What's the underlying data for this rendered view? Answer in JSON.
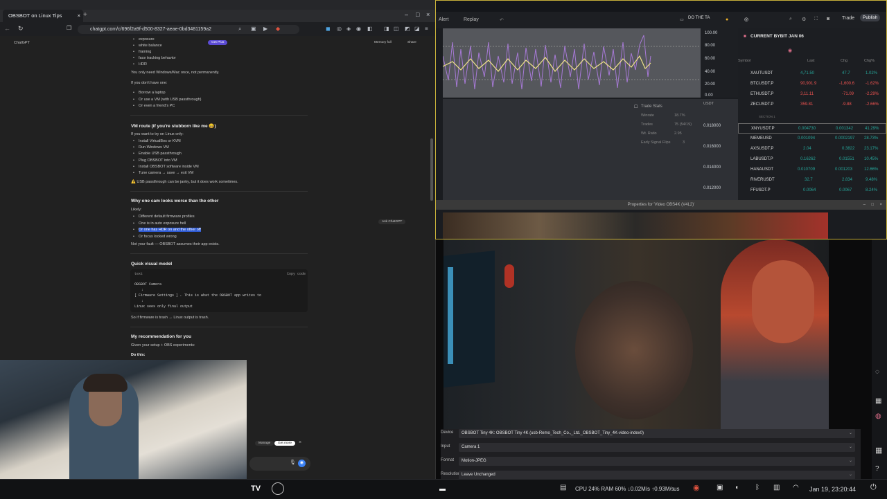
{
  "browser": {
    "tabs": [
      {
        "label": "OBSBOT on Linux Tips",
        "active": true
      },
      {
        "label": "",
        "active": false
      },
      {
        "label": "",
        "active": false
      },
      {
        "label": "",
        "active": false
      }
    ],
    "url": "chatgpt.com/c/696f2a9f-d500-8327-aeae-0bd3481159a2"
  },
  "chat": {
    "app_label": "ChatGPT",
    "get_plus": "Get Plus",
    "memory": "Memory full",
    "share": "Share",
    "intro_bullets": [
      "exposure",
      "white balance",
      "framing",
      "face tracking behavior",
      "HDR"
    ],
    "line1": "You only need Windows/Mac once, not permanently.",
    "line2": "If you don't have one:",
    "borrow_bullets": [
      "Borrow a laptop",
      "Or use a VM (with USB passthrough)",
      "Or even a friend's PC"
    ],
    "vm_heading": "VM route (if you're stubborn like me 😄)",
    "vm_intro": "If you want to try on Linux only:",
    "vm_bullets": [
      "Install VirtualBox or KVM",
      "Run Windows VM",
      "Enable USB passthrough",
      "Plug OBSBOT into VM",
      "Install OBSBOT software inside VM",
      "Tune camera → save → exit VM"
    ],
    "vm_warning": "⚠️ USB passthrough can be janky, but it does work sometimes.",
    "why_heading": "Why one cam looks worse than the other",
    "why_intro": "Likely:",
    "why_bullets": [
      "Different default firmware profiles",
      "One is in auto exposure hell",
      "Or one has HDR on and the other off",
      "Or focus locked wrong"
    ],
    "ask_chatgpt": "Ask ChatGPT",
    "why_footer": "Not your fault — OBSBOT assumes their app exists.",
    "visual_heading": "Quick visual model",
    "code_lang": "text",
    "copy_code": "Copy code",
    "code_lines": [
      "OBSBOT Camera",
      "↓",
      "[ Firmware Settings ] ← This is what the OBSBOT app writes to",
      "↓",
      "Linux sees only final output"
    ],
    "visual_footer": "So if firmware is trash → Linux output is trash.",
    "rec_heading": "My recommendation for you",
    "rec_intro": "Given your setup + OBS experiments:",
    "do_this": "Do this:",
    "manage": "Manage",
    "get_more": "Get more"
  },
  "trading": {
    "alert": "Alert",
    "replay": "Replay",
    "do_the": "DO THE TA",
    "trade": "Trade",
    "publish": "Publish",
    "price_ticks": [
      "100.00",
      "80.00",
      "60.00",
      "40.00",
      "20.00",
      "0.00"
    ],
    "lower_ticks": [
      "0.018000",
      "0.016000",
      "0.014000",
      "0.012000"
    ],
    "usdt": "USDT",
    "stats_title": "Trade Stats",
    "stats": [
      {
        "label": "Winrate",
        "value": "18.7%"
      },
      {
        "label": "Trades",
        "value": "75 (54/19)"
      },
      {
        "label": "Wt. Ratio",
        "value": "2.95"
      },
      {
        "label": "Early Signal Flips",
        "value": "3"
      }
    ],
    "watchlist_title": "CURRENT BYBIT JAN 06",
    "wl_headers": [
      "Symbol",
      "Last",
      "Chg",
      "Chg%"
    ],
    "watchlist": [
      {
        "symbol": "XAUTUSDT",
        "last": "4,71.50",
        "chg": "47.7",
        "pct": "1.02%",
        "color": "#26a69a"
      },
      {
        "symbol": "BTCUSDT.P",
        "last": "90,901.9",
        "chg": "-1,600.6",
        "pct": "-1.62%",
        "color": "#ef5350"
      },
      {
        "symbol": "ETHUSDT.P",
        "last": "3,11.11",
        "chg": "-71.09",
        "pct": "-2.29%",
        "color": "#ef5350"
      },
      {
        "symbol": "ZECUSDT.P",
        "last": "359.81",
        "chg": "-9.88",
        "pct": "-2.66%",
        "color": "#ef5350"
      },
      {
        "symbol": "SECTION 1",
        "last": "",
        "chg": "",
        "pct": "",
        "color": "#888888"
      },
      {
        "symbol": "XNYUSDT.P",
        "last": "0.004730",
        "chg": "0.001342",
        "pct": "41.29%",
        "color": "#26a69a"
      },
      {
        "symbol": "MEMEUSD",
        "last": "0.001094",
        "chg": "0.0002197",
        "pct": "28.73%",
        "color": "#26a69a"
      },
      {
        "symbol": "AXSUSDT.P",
        "last": "2.04",
        "chg": "0.3822",
        "pct": "23.17%",
        "color": "#26a69a"
      },
      {
        "symbol": "LABUSDT.P",
        "last": "0.16262",
        "chg": "0.01551",
        "pct": "10.45%",
        "color": "#26a69a"
      },
      {
        "symbol": "HANAUSDT",
        "last": "0.010709",
        "chg": "0.001203",
        "pct": "12.66%",
        "color": "#26a69a"
      },
      {
        "symbol": "RIVERUSDT",
        "last": "32.7",
        "chg": "2.834",
        "pct": "9.48%",
        "color": "#26a69a"
      },
      {
        "symbol": "FFUSDT.P",
        "last": "0.0064",
        "chg": "0.0067",
        "pct": "8.24%",
        "color": "#26a69a"
      }
    ],
    "properties_title": "Properties for 'Video OBS4K (V4L2)'"
  },
  "obs_props": {
    "rows": [
      {
        "label": "Device",
        "value": "OBSBOT Tiny 4K: OBSBOT Tiny 4K (usb-Remo_Tech_Co.,_Ltd._OBSBOT_Tiny_4K-video-index0)"
      },
      {
        "label": "Input",
        "value": "Camera 1"
      },
      {
        "label": "Format",
        "value": "Motion-JPEG"
      },
      {
        "label": "Resolution",
        "value": "Leave Unchanged"
      }
    ]
  },
  "taskbar": {
    "sysinfo": "CPU 24% RAM 60% ↓0.02M/s ↑0.93M/s",
    "lang": "us",
    "clock": "Jan 19, 23:20:44"
  }
}
